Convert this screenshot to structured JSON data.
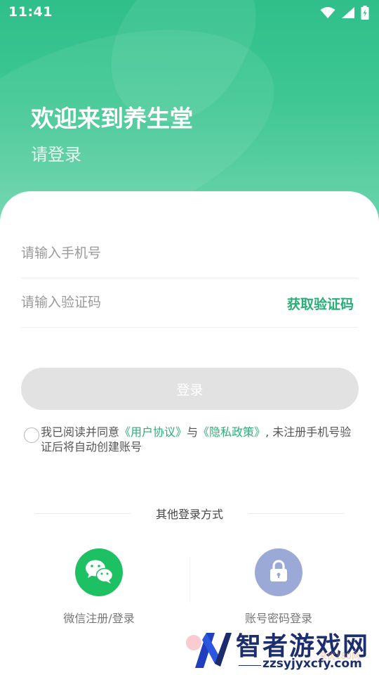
{
  "status_bar": {
    "time": "11:41"
  },
  "hero": {
    "title": "欢迎来到养生堂",
    "subtitle": "请登录"
  },
  "form": {
    "phone_placeholder": "请输入手机号",
    "phone_value": "",
    "code_placeholder": "请输入验证码",
    "code_value": "",
    "get_code_label": "获取验证码",
    "login_label": "登录"
  },
  "agreement": {
    "checked": false,
    "prefix": "我已阅读并同意",
    "user_agreement": "《用户协议》",
    "conjunction": "与",
    "privacy_policy": "《隐私政策》",
    "suffix": ", 未注册手机号验证后将自动创建账号"
  },
  "other_login": {
    "title": "其他登录方式",
    "wechat_label": "微信注册/登录",
    "password_label": "账号密码登录"
  },
  "watermark": {
    "title": "智者游戏网",
    "url": "zzsyjyxcfy.com",
    "faint_text": "来优180网"
  },
  "colors": {
    "accent": "#2aae78",
    "hero_top": "#2fbf8a",
    "wechat": "#1dc163",
    "password": "#9aa9d6",
    "button_disabled": "#e2e2e2"
  },
  "icons": [
    "wifi-icon",
    "signal-icon",
    "battery-icon",
    "wechat-icon",
    "lock-icon",
    "watermark-logo-icon"
  ]
}
